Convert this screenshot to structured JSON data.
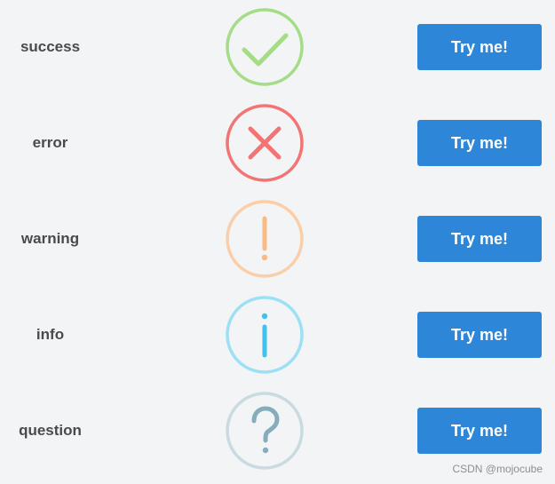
{
  "rows": [
    {
      "label": "success",
      "button_label": "Try me!",
      "icon": "check-icon",
      "color": "#a5dc86"
    },
    {
      "label": "error",
      "button_label": "Try me!",
      "icon": "x-mark-icon",
      "color": "#f27474"
    },
    {
      "label": "warning",
      "button_label": "Try me!",
      "icon": "exclamation-icon",
      "color": "#f8bb86"
    },
    {
      "label": "info",
      "button_label": "Try me!",
      "icon": "info-icon",
      "color": "#3fc3ee"
    },
    {
      "label": "question",
      "button_label": "Try me!",
      "icon": "question-icon",
      "color": "#87adbd"
    }
  ],
  "colors": {
    "button": "#2e86d9",
    "background": "#f3f4f6",
    "question_ring": "#c9dae1",
    "warning_ring": "#facea8",
    "info_ring": "#9de0f6"
  },
  "watermark": "CSDN @mojocube"
}
